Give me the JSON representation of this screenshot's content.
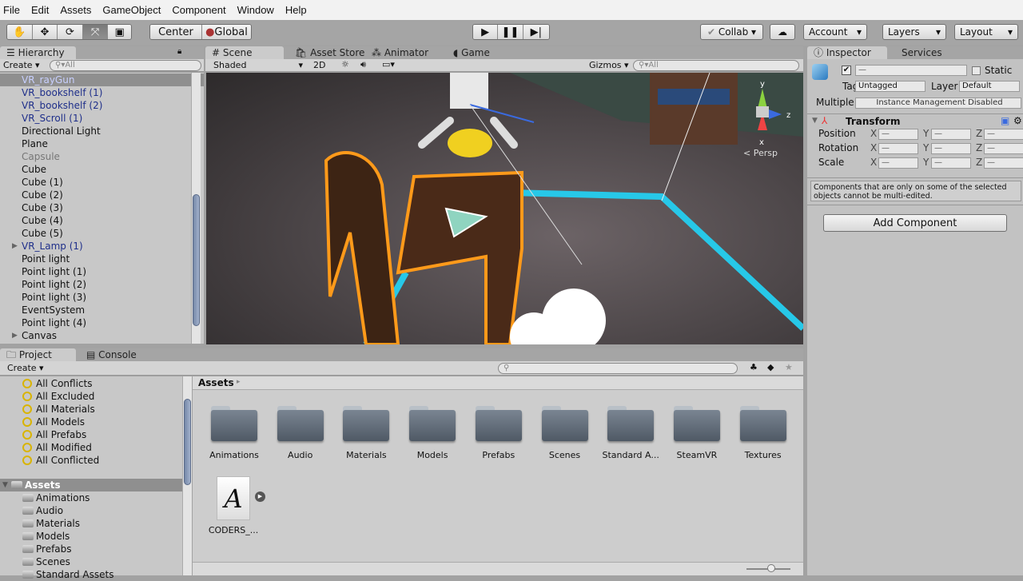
{
  "menu": [
    "File",
    "Edit",
    "Assets",
    "GameObject",
    "Component",
    "Window",
    "Help"
  ],
  "toolbar": {
    "tools": [
      "hand-icon",
      "move-icon",
      "rotate-icon",
      "scale-icon",
      "rect-icon"
    ],
    "pivot": "Center",
    "space": "Global",
    "collab": "Collab",
    "account": "Account",
    "layers": "Layers",
    "layout": "Layout"
  },
  "hierarchy": {
    "tab": "Hierarchy",
    "create": "Create",
    "search": "All",
    "items": [
      {
        "label": "VR_rayGun",
        "type": "sel"
      },
      {
        "label": "VR_bookshelf (1)",
        "type": "prefab"
      },
      {
        "label": "VR_bookshelf (2)",
        "type": "prefab"
      },
      {
        "label": "VR_Scroll (1)",
        "type": "prefab"
      },
      {
        "label": "Directional Light",
        "type": ""
      },
      {
        "label": "Plane",
        "type": ""
      },
      {
        "label": "Capsule",
        "type": "dis"
      },
      {
        "label": "Cube",
        "type": ""
      },
      {
        "label": "Cube (1)",
        "type": ""
      },
      {
        "label": "Cube (2)",
        "type": ""
      },
      {
        "label": "Cube (3)",
        "type": ""
      },
      {
        "label": "Cube (4)",
        "type": ""
      },
      {
        "label": "Cube (5)",
        "type": ""
      },
      {
        "label": "VR_Lamp (1)",
        "type": "prefab",
        "expand": true
      },
      {
        "label": "Point light",
        "type": ""
      },
      {
        "label": "Point light (1)",
        "type": ""
      },
      {
        "label": "Point light (2)",
        "type": ""
      },
      {
        "label": "Point light (3)",
        "type": ""
      },
      {
        "label": "EventSystem",
        "type": ""
      },
      {
        "label": "Point light (4)",
        "type": ""
      },
      {
        "label": "Canvas",
        "type": "",
        "expand": true
      }
    ]
  },
  "scene": {
    "tabs": [
      "Scene",
      "Asset Store",
      "Animator",
      "Game"
    ],
    "shading": "Shaded",
    "mode2d": "2D",
    "gizmos": "Gizmos",
    "search": "All",
    "persp": "< Persp",
    "axes": {
      "y": "y",
      "x": "x",
      "z": "z"
    }
  },
  "inspector": {
    "tabs": [
      "Inspector",
      "Services"
    ],
    "name": "—",
    "static": "Static",
    "tag_label": "Tag",
    "tag": "Untagged",
    "layer_label": "Layer",
    "layer": "Default",
    "multiple_label": "Multiple",
    "multiple": "Instance Management Disabled",
    "transform": {
      "title": "Transform",
      "rows": [
        {
          "label": "Position"
        },
        {
          "label": "Rotation"
        },
        {
          "label": "Scale"
        }
      ],
      "axes": [
        "X",
        "Y",
        "Z"
      ],
      "value": "—"
    },
    "note": "Components that are only on some of the selected objects cannot be multi-edited.",
    "add": "Add Component"
  },
  "project": {
    "tabs": [
      "Project",
      "Console"
    ],
    "create": "Create",
    "favorites": [
      "All Conflicts",
      "All Excluded",
      "All Materials",
      "All Models",
      "All Prefabs",
      "All Modified",
      "All Conflicted"
    ],
    "root": "Assets",
    "folders": [
      "Animations",
      "Audio",
      "Materials",
      "Models",
      "Prefabs",
      "Scenes",
      "Standard Assets"
    ],
    "breadcrumb": "Assets",
    "grid": [
      "Animations",
      "Audio",
      "Materials",
      "Models",
      "Prefabs",
      "Scenes",
      "Standard A...",
      "SteamVR",
      "Textures"
    ],
    "font_asset": "CODERS_...",
    "font_glyph": "A"
  },
  "colors": {
    "selection": "#8f8f8f",
    "prefab": "#1f2f8a",
    "outline": "#ff9a1a",
    "floor_edge": "#27c8e8"
  }
}
